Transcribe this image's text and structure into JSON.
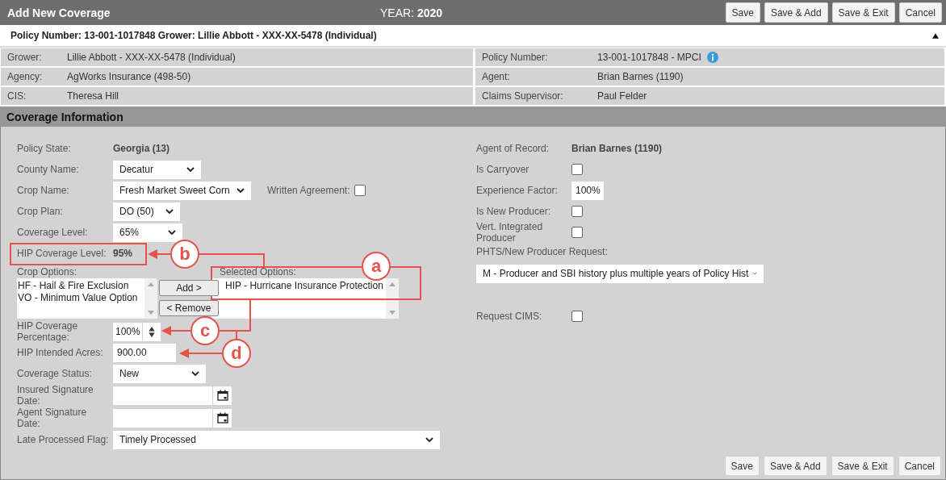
{
  "header": {
    "title": "Add New Coverage",
    "year_label": "YEAR:",
    "year": "2020",
    "buttons": [
      "Save",
      "Save & Add",
      "Save & Exit",
      "Cancel"
    ]
  },
  "policy_summary": {
    "text": "Policy Number: 13-001-1017848 Grower: Lillie Abbott - XXX-XX-5478 (Individual)",
    "expanded": true
  },
  "info": {
    "left": [
      {
        "label": "Grower:",
        "value": "Lillie Abbott - XXX-XX-5478 (Individual)",
        "info_icon": false
      },
      {
        "label": "Agency:",
        "value": "AgWorks Insurance (498-50)",
        "info_icon": false
      },
      {
        "label": "CIS:",
        "value": "Theresa Hill",
        "info_icon": false
      }
    ],
    "right": [
      {
        "label": "Policy Number:",
        "value": "13-001-1017848 - MPCI",
        "info_icon": true
      },
      {
        "label": "Agent:",
        "value": "Brian Barnes (1190)",
        "info_icon": false
      },
      {
        "label": "Claims Supervisor:",
        "value": "Paul Felder",
        "info_icon": false
      }
    ]
  },
  "section_title": "Coverage Information",
  "form_left": [
    {
      "kind": "static",
      "label": "Policy State:",
      "value": "Georgia (13)"
    },
    {
      "kind": "select",
      "label": "County Name:",
      "value": "Decatur"
    },
    {
      "kind": "select",
      "label": "Crop Name:",
      "value": "Fresh Market Sweet Corn",
      "check_label": "Written Agreement:",
      "checked": false
    },
    {
      "kind": "select",
      "label": "Crop Plan:",
      "value": "DO (50)"
    },
    {
      "kind": "select",
      "label": "Coverage Level:",
      "value": "65%"
    },
    {
      "kind": "static",
      "label": "HIP Coverage Level:",
      "value": "95%"
    },
    {
      "kind": "transfer",
      "label": "Crop Options:",
      "items": [
        "HF - Hail & Fire Exclusion",
        "VO - Minimum Value Option"
      ],
      "add": "Add >",
      "remove": "< Remove",
      "selected_label": "Selected Options:",
      "selected_items": [
        "HIP - Hurricane Insurance Protection"
      ]
    },
    {
      "kind": "spinner",
      "label": "HIP Coverage Percentage:",
      "value": "100%"
    },
    {
      "kind": "input",
      "label": "HIP Intended Acres:",
      "value": "900.00"
    },
    {
      "kind": "select",
      "label": "Coverage Status:",
      "value": "New"
    },
    {
      "kind": "date",
      "label": "Insured Signature Date:"
    },
    {
      "kind": "date",
      "label": "Agent Signature Date:"
    },
    {
      "kind": "select",
      "label": "Late Processed Flag:",
      "value": "Timely Processed"
    }
  ],
  "form_right": [
    {
      "kind": "static",
      "label": "Agent of Record:",
      "value": "Brian Barnes (1190)"
    },
    {
      "kind": "checkbox",
      "label": "Is Carryover",
      "checked": false
    },
    {
      "kind": "input",
      "label": "Experience Factor:",
      "value": "100%"
    },
    {
      "kind": "checkbox",
      "label": "Is New Producer:",
      "checked": false
    },
    {
      "kind": "checkbox",
      "label": "Vert. Integrated Producer",
      "checked": false
    },
    {
      "kind": "stacked_select",
      "label": "PHTS/New Producer Request:",
      "value": "M - Producer and SBI history plus multiple years of Policy Hist"
    },
    {
      "kind": "checkbox",
      "label": "Request CIMS:",
      "checked": false
    }
  ],
  "footer_buttons": [
    "Save",
    "Save & Add",
    "Save & Exit",
    "Cancel"
  ],
  "annotations": [
    {
      "label": "a"
    },
    {
      "label": "b"
    },
    {
      "label": "c"
    },
    {
      "label": "d"
    }
  ]
}
